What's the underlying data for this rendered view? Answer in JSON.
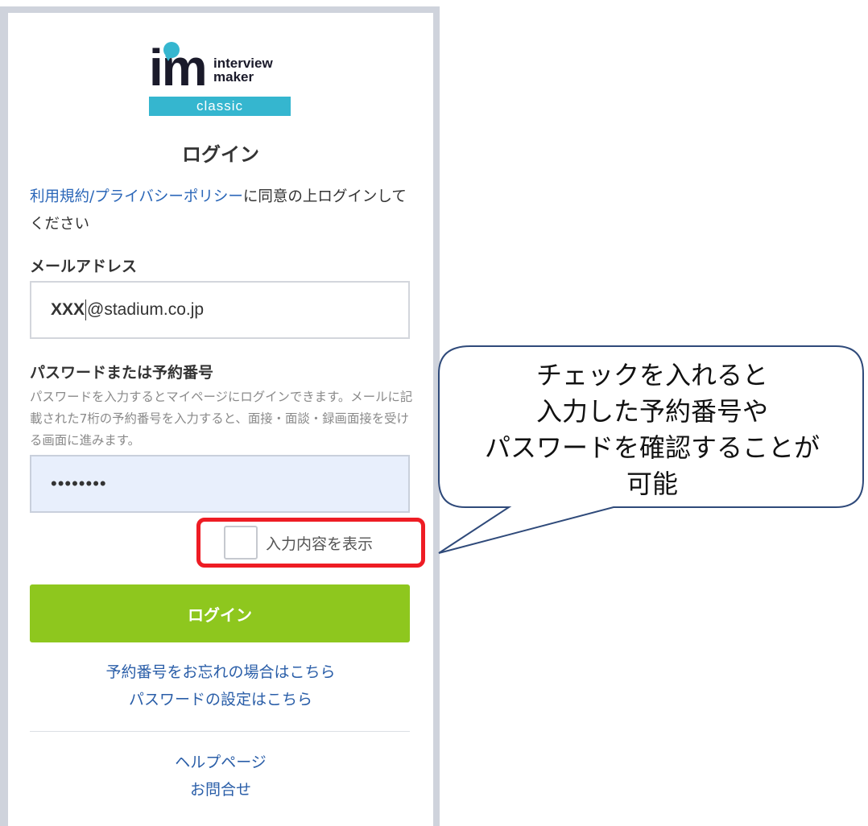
{
  "logo": {
    "mark": "im",
    "brand_line1": "interview",
    "brand_line2": "maker",
    "edition": "classic"
  },
  "login": {
    "title": "ログイン",
    "terms_link": "利用規約/プライバシーポリシー",
    "terms_text": "に同意の上ログインしてください",
    "email_label": "メールアドレス",
    "email_value_masked": "XXX",
    "email_value_domain": "@stadium.co.jp",
    "password_label": "パスワードまたは予約番号",
    "password_hint": "パスワードを入力するとマイページにログインできます。メールに記載された7桁の予約番号を入力すると、面接・面談・録画面接を受ける画面に進みます。",
    "password_value": "••••••••",
    "show_toggle_label": "入力内容を表示",
    "login_button": "ログイン",
    "forgot_link": "予約番号をお忘れの場合はこちら",
    "password_setting_link": "パスワードの設定はこちら",
    "help_link": "ヘルプページ",
    "contact_link": "お問合せ"
  },
  "callout": {
    "line1": "チェックを入れると",
    "line2": "入力した予約番号や",
    "line3": "パスワードを確認することが",
    "line4": "可能"
  },
  "colors": {
    "accent_link": "#2a66b8",
    "login_button": "#8ec71e",
    "brand_teal": "#35b6cf",
    "highlight_red": "#ee1c24",
    "bubble_border": "#2f4a7a"
  }
}
